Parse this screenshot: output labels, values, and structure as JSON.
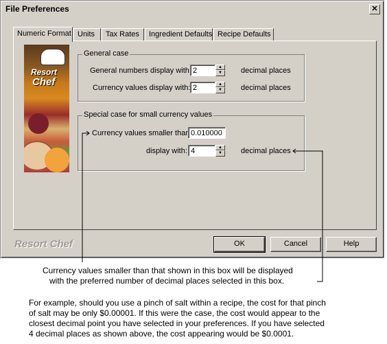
{
  "window": {
    "title": "File Preferences",
    "close_glyph": "✕"
  },
  "tabs": [
    {
      "label": "Numeric Format",
      "active": true
    },
    {
      "label": "Units"
    },
    {
      "label": "Tax Rates"
    },
    {
      "label": "Ingredient Defaults"
    },
    {
      "label": "Recipe Defaults"
    }
  ],
  "image": {
    "logo_line1": "Resort",
    "logo_line2": "Chef"
  },
  "general_case": {
    "legend": "General case",
    "numbers_label": "General numbers display with:",
    "numbers_value": "2",
    "currency_label": "Currency values display with:",
    "currency_value": "2",
    "suffix": "decimal places"
  },
  "special_case": {
    "legend": "Special case for small currency values",
    "smaller_label": "Currency values smaller than:",
    "smaller_value": "0.010000",
    "display_label": "display with:",
    "display_value": "4",
    "suffix": "decimal places"
  },
  "footer": {
    "brand": "Resort Chef",
    "ok_label": "OK",
    "cancel_label": "Cancel",
    "help_label": "Help"
  },
  "annotations": {
    "callout_line1": "Currency values smaller than that shown in this box will be displayed",
    "callout_line2": "with the preferred number of decimal places selected in this box.",
    "example_line1": "For example, should you use a pinch of salt within a recipe, the cost for that pinch",
    "example_line2": "of salt may be only $0.00001.  If this were the case, the cost would appear to the",
    "example_line3": "closest decimal point you have selected in your preferences.  If you have selected",
    "example_line4": "4 decimal places as shown above, the cost appearing would be $0.0001."
  }
}
